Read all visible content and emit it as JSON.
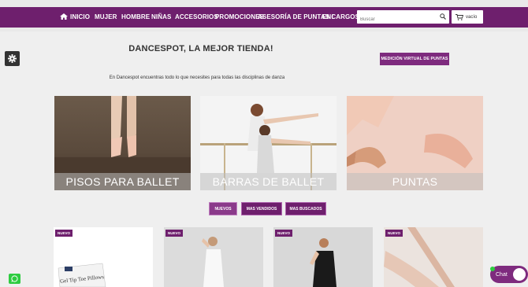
{
  "nav": {
    "items": [
      "INICIO",
      "MUJER",
      "HOMBRE",
      "NIÑAS",
      "ACCESORIOS",
      "PROMOCIONES",
      "ASESORÍA DE PUNTAS !",
      "ENCARGOS"
    ],
    "search_placeholder": "Buscar",
    "cart_label": "vacío"
  },
  "header": {
    "title": "DANCESPOT, LA MEJOR TIENDA!",
    "subtitle": "En Dancespot encuentras todo lo que necesites para todas las disciplinas de danza",
    "measure_button": "MEDICIÓN VIRTUAL DE PUNTAS"
  },
  "categories": [
    {
      "label": "PISOS PARA BALLET"
    },
    {
      "label": "BARRAS DE BALLET"
    },
    {
      "label": "PUNTAS"
    }
  ],
  "tabs": [
    "NUEVOS",
    "MAS VENDIDOS",
    "MAS BUSCADOS"
  ],
  "products": [
    {
      "badge": "NUEVO",
      "image_text": "Gel Tip Toe Pillows"
    },
    {
      "badge": "NUEVO"
    },
    {
      "badge": "NUEVO"
    },
    {
      "badge": "NUEVO"
    }
  ],
  "widgets": {
    "chat_label": "Chat"
  },
  "colors": {
    "brand_purple": "#6e1f6d",
    "accent_purple": "#7e2b7e",
    "whatsapp_green": "#2ecc40"
  }
}
